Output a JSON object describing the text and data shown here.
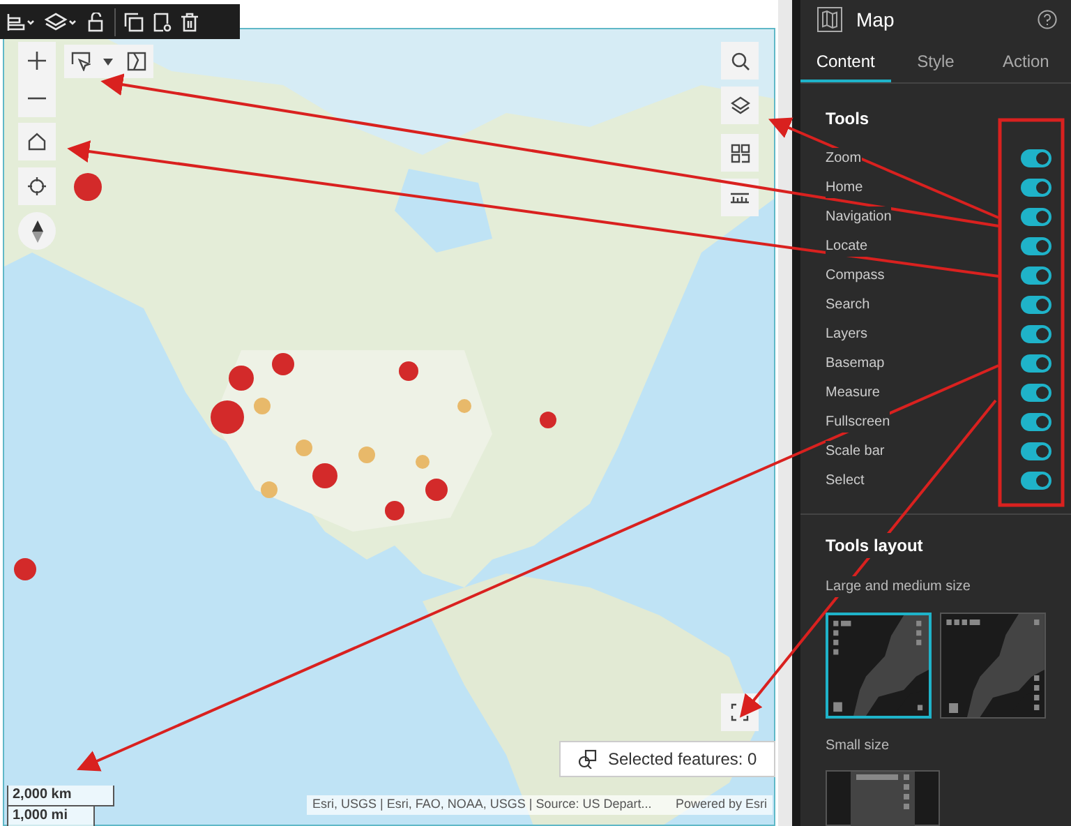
{
  "map": {
    "kind": "picture",
    "selected_features": "Selected features: 0",
    "scale_bar": [
      "2,000 km",
      "1,000 mi"
    ],
    "attribution": "Esri, USGS | Esri, FAO, NOAA, USGS | Source: US Depart...",
    "powered_by": "Powered by Esri"
  },
  "panel": {
    "title": "Map",
    "tabs": [
      {
        "label": "Content",
        "selected": true
      },
      {
        "label": "Style",
        "selected": false
      },
      {
        "label": "Action",
        "selected": false
      }
    ],
    "tools_heading": "Tools",
    "tools": [
      {
        "label": "Zoom",
        "on": true
      },
      {
        "label": "Home",
        "on": true
      },
      {
        "label": "Navigation",
        "on": true
      },
      {
        "label": "Locate",
        "on": true
      },
      {
        "label": "Compass",
        "on": true
      },
      {
        "label": "Search",
        "on": true
      },
      {
        "label": "Layers",
        "on": true
      },
      {
        "label": "Basemap",
        "on": true
      },
      {
        "label": "Measure",
        "on": true
      },
      {
        "label": "Fullscreen",
        "on": true
      },
      {
        "label": "Scale bar",
        "on": true
      },
      {
        "label": "Select",
        "on": true
      }
    ],
    "layout_heading": "Tools layout",
    "large_label": "Large and medium size",
    "large_layouts": [
      {
        "selected": true
      },
      {
        "selected": false
      }
    ],
    "small_label": "Small size"
  }
}
